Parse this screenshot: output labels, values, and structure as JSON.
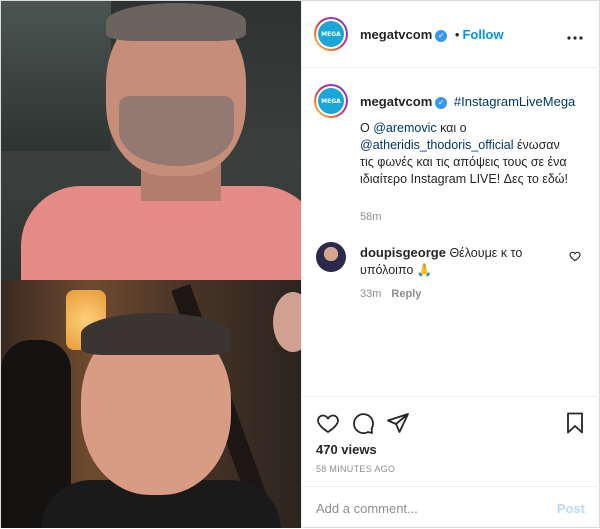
{
  "header": {
    "username": "megatvcom",
    "separator": "•",
    "follow_label": "Follow",
    "more_label": "•••",
    "avatar_text": "MEGA"
  },
  "caption": {
    "username": "megatvcom",
    "hashtag": "#InstagramLiveMega",
    "text_1": "Ο ",
    "mention_1": "@aremovic",
    "text_2": " και ο ",
    "mention_2": "@atheridis_thodoris_official",
    "text_3": " ένωσαν τις φωνές και τις απόψεις τους σε ένα ιδιαίτερο Instagram LIVE! Δες το εδώ!",
    "time": "58m"
  },
  "comment": {
    "username": "doupisgeorge",
    "text": "Θέλουμε κ το υπόλοιπο 🙏",
    "time": "33m",
    "reply_label": "Reply"
  },
  "stats": {
    "views": "470 views",
    "posted": "58 MINUTES AGO"
  },
  "add_comment": {
    "placeholder": "Add a comment...",
    "post_label": "Post"
  },
  "icons": {
    "like": "heart-icon",
    "comment": "comment-icon",
    "share": "share-icon",
    "save": "bookmark-icon",
    "more": "more-options-icon",
    "verified": "verified-badge-icon"
  },
  "colors": {
    "link": "#0095f6",
    "mention": "#00376b",
    "muted": "#8e8e8e",
    "verified": "#3897f0"
  }
}
